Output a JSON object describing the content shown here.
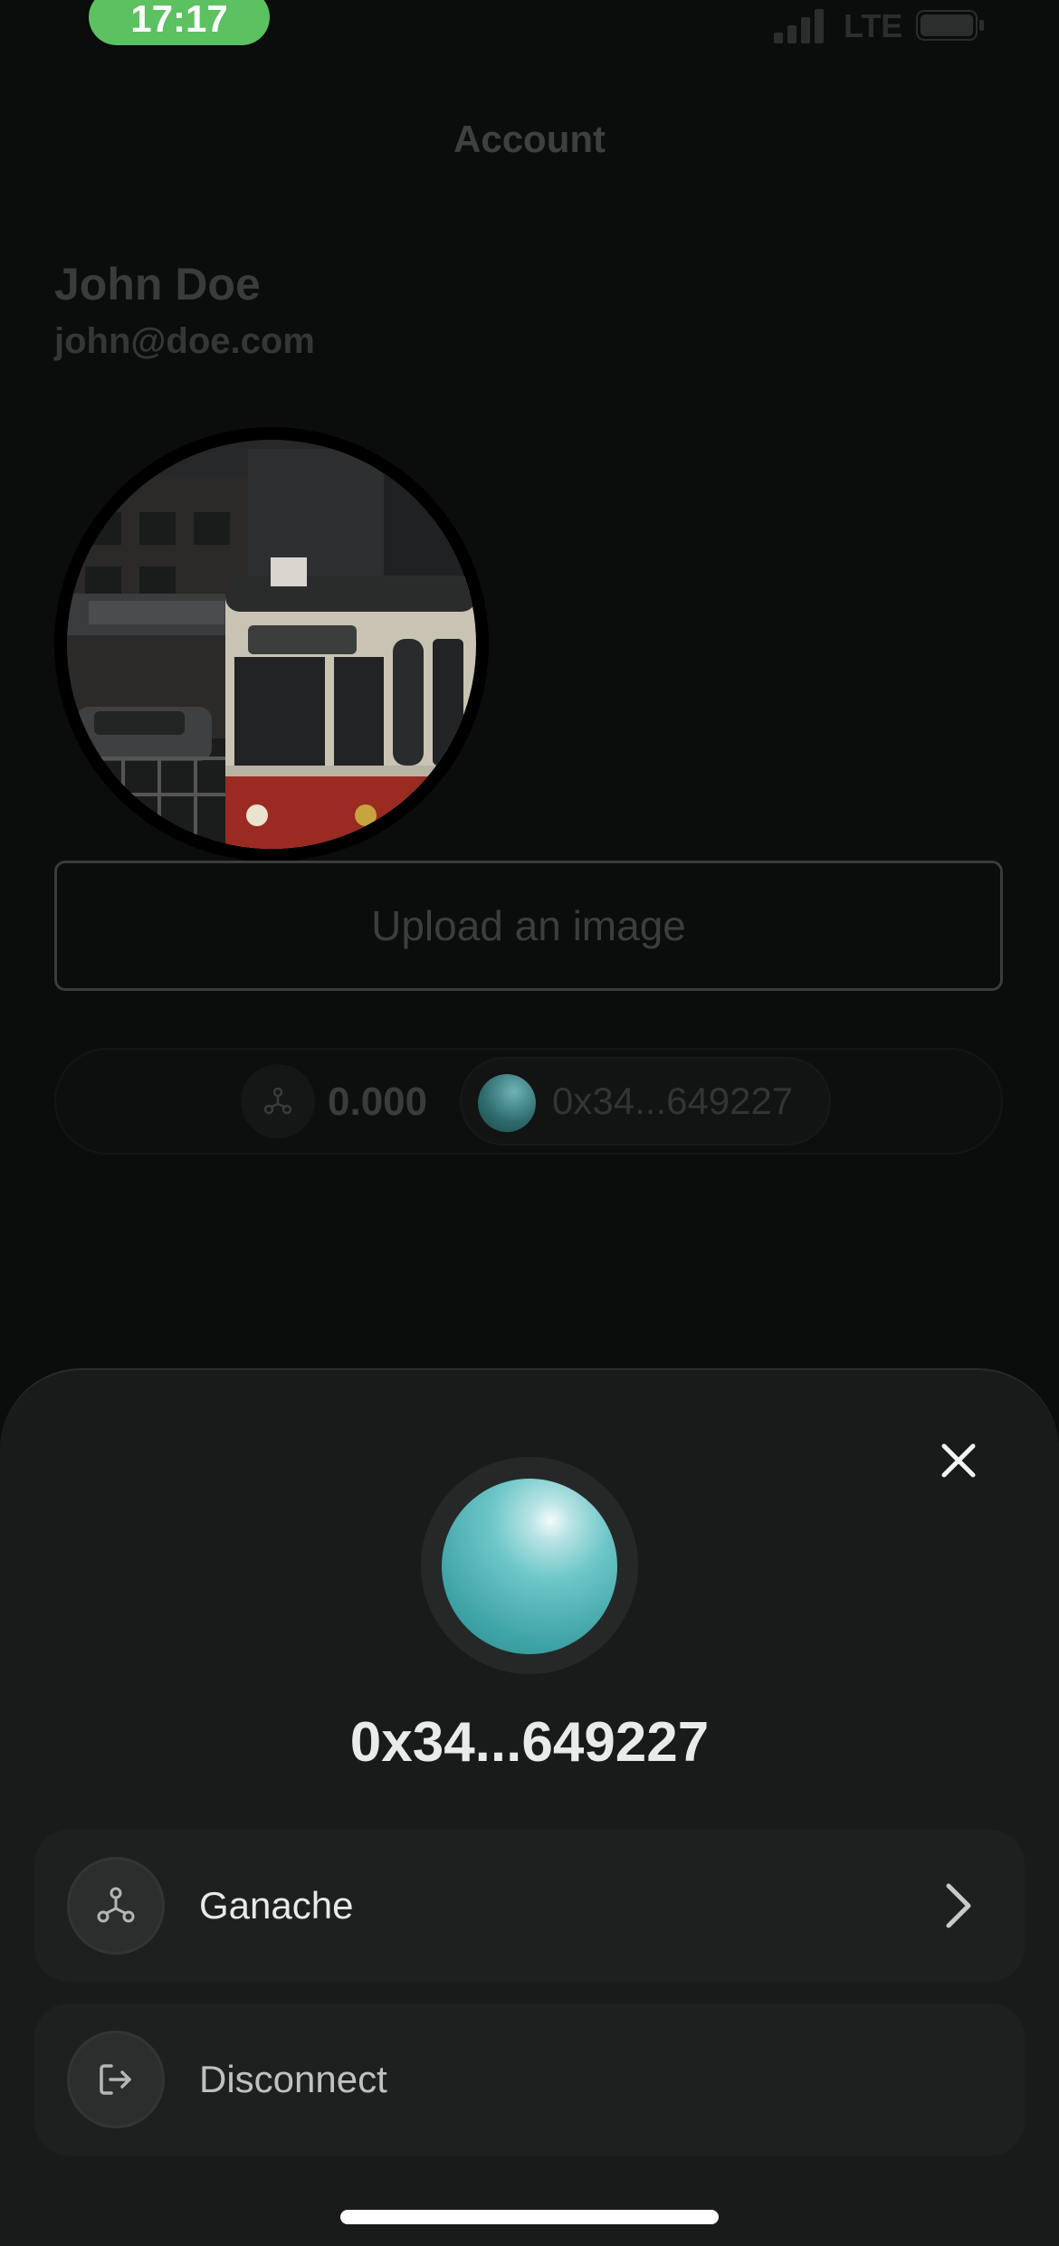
{
  "status_bar": {
    "time": "17:17",
    "network": "LTE",
    "time_pill_color": "#5cc160"
  },
  "page": {
    "title": "Account",
    "user": {
      "name": "John Doe",
      "email": "john@doe.com"
    },
    "upload_button_label": "Upload an image",
    "wallet_chip": {
      "balance": "0.000",
      "network_icon": "ganache-network-icon",
      "address": "0x34...649227"
    }
  },
  "sheet": {
    "close_icon": "close-icon",
    "address": "0x34...649227",
    "avatar_color": "#5bbcbf",
    "rows": [
      {
        "label": "Ganache",
        "icon": "ganache-network-icon",
        "has_chevron": true
      },
      {
        "label": "Disconnect",
        "icon": "logout-icon",
        "has_chevron": false
      }
    ]
  }
}
